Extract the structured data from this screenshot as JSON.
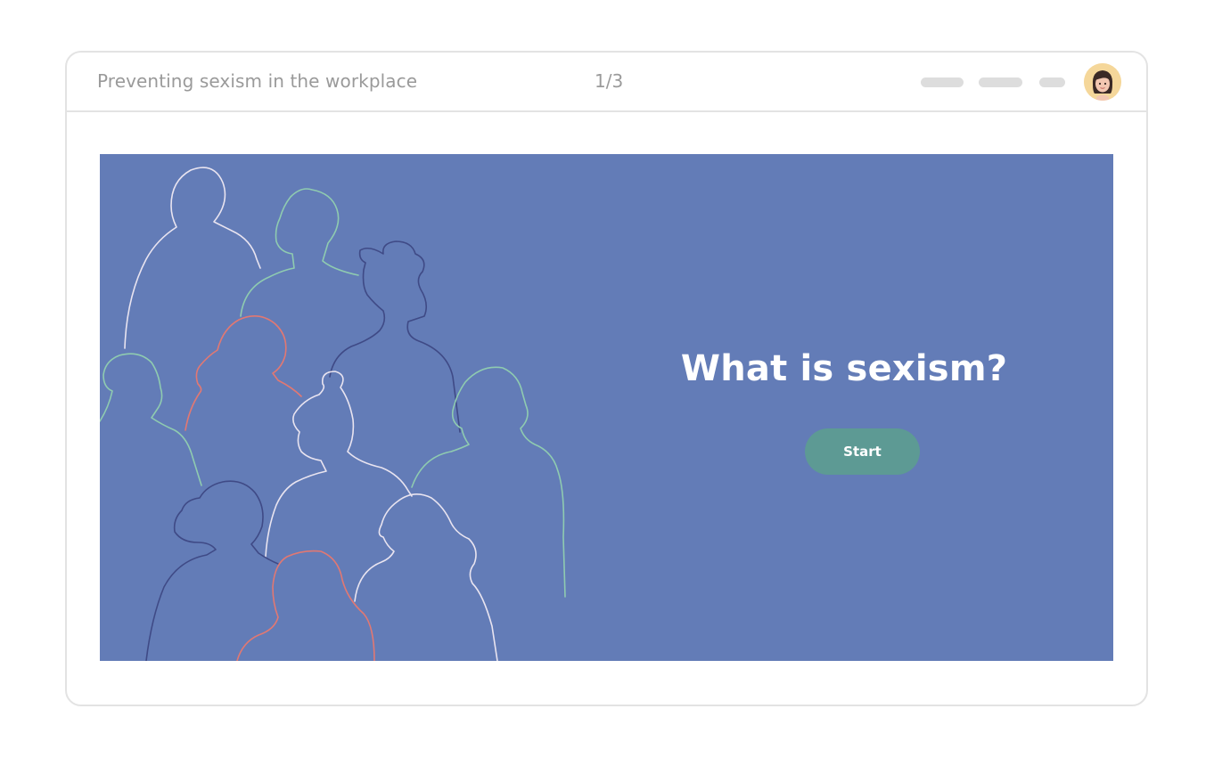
{
  "header": {
    "course_title": "Preventing sexism in the workplace",
    "page_counter": "1/3",
    "nav_pills": [
      "nav-pill",
      "nav-pill",
      "nav-pill"
    ],
    "avatar_icon": "user-avatar-icon"
  },
  "slide": {
    "title": "What is sexism?",
    "start_label": "Start",
    "illustration": "people-silhouettes-illustration"
  },
  "colors": {
    "slide_background": "#637cb7",
    "button": "#5d9a94",
    "line_white": "#e9e4f0",
    "line_green": "#8fcbb0",
    "line_dark": "#3f4a86",
    "line_coral": "#e27872",
    "avatar_background": "#f5d79a"
  }
}
